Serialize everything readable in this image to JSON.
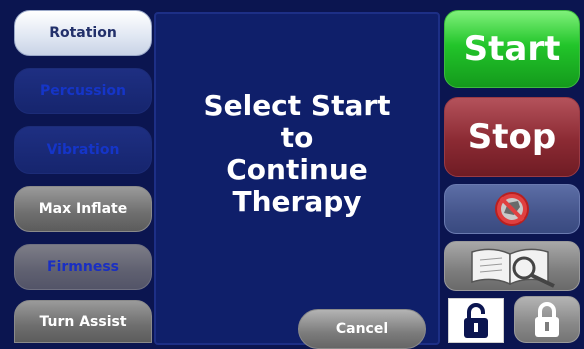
{
  "left_menu": {
    "rotation": "Rotation",
    "percussion": "Percussion",
    "vibration": "Vibration",
    "max_inflate": "Max Inflate",
    "firmness": "Firmness",
    "turn_assist": "Turn Assist"
  },
  "dialog": {
    "line1": "Select Start",
    "line2": "to",
    "line3": "Continue",
    "line4": "Therapy",
    "cancel_label": "Cancel"
  },
  "right_panel": {
    "start_label": "Start",
    "stop_label": "Stop",
    "mute_icon": "alarm-mute-icon",
    "manual_icon": "manual-search-icon",
    "unlock_icon": "unlocked-padlock-icon",
    "lock_icon": "locked-padlock-icon"
  },
  "colors": {
    "background": "#0b1550",
    "start_green": "#22c52a",
    "stop_red": "#8b2a33",
    "dialog_bg": "#0f1f6a"
  }
}
